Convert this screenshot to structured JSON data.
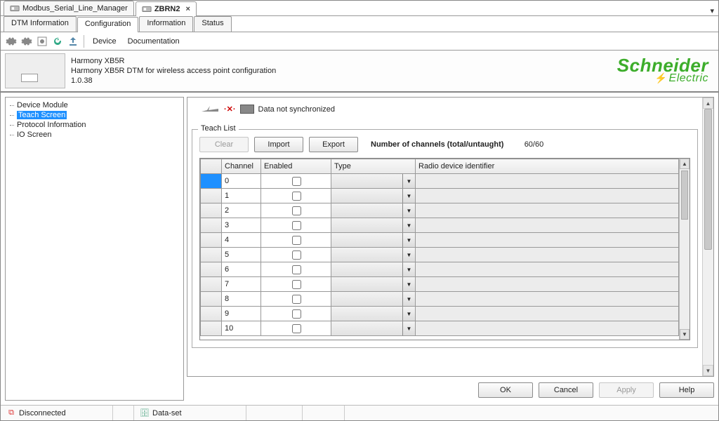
{
  "outerTabs": {
    "tab1": "Modbus_Serial_Line_Manager",
    "tab2": "ZBRN2"
  },
  "secTabs": {
    "t1": "DTM Information",
    "t2": "Configuration",
    "t3": "Information",
    "t4": "Status"
  },
  "toolbar": {
    "menu_device": "Device",
    "menu_docs": "Documentation"
  },
  "device": {
    "title": "Harmony XB5R",
    "desc": "Harmony XB5R DTM for wireless access point configuration",
    "version": "1.0.38"
  },
  "brand": {
    "main": "Schneider",
    "sub": "Electric"
  },
  "tree": {
    "n0": "Device Module",
    "n1": "Teach Screen",
    "n2": "Protocol Information",
    "n3": "IO Screen"
  },
  "sync": {
    "text": "Data not synchronized"
  },
  "teach": {
    "legend": "Teach List",
    "btn_clear": "Clear",
    "btn_import": "Import",
    "btn_export": "Export",
    "channels_label": "Number of channels (total/untaught)",
    "channels_value": "60/60",
    "hdr_channel": "Channel",
    "hdr_enabled": "Enabled",
    "hdr_type": "Type",
    "hdr_radio": "Radio device identifier",
    "rows": {
      "r0": "0",
      "r1": "1",
      "r2": "2",
      "r3": "3",
      "r4": "4",
      "r5": "5",
      "r6": "6",
      "r7": "7",
      "r8": "8",
      "r9": "9",
      "r10": "10"
    }
  },
  "dialog": {
    "ok": "OK",
    "cancel": "Cancel",
    "apply": "Apply",
    "help": "Help"
  },
  "status": {
    "conn": "Disconnected",
    "dataset": "Data-set"
  }
}
